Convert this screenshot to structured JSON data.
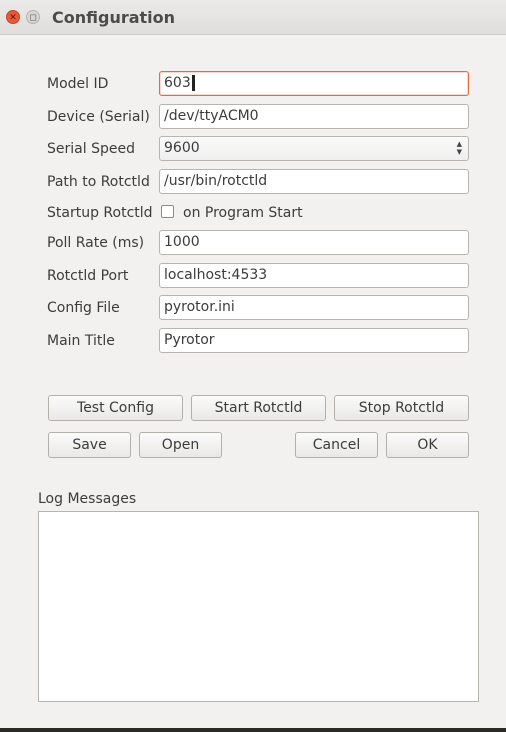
{
  "window": {
    "title": "Configuration",
    "close_glyph": "✕",
    "min_glyph": "◻"
  },
  "form": {
    "model_id": {
      "label": "Model ID",
      "value": "603"
    },
    "device": {
      "label": "Device (Serial)",
      "value": "/dev/ttyACM0"
    },
    "serial_speed": {
      "label": "Serial Speed",
      "value": "9600",
      "spin_up": "▲",
      "spin_down": "▼"
    },
    "rotctld_path": {
      "label": "Path to Rotctld",
      "value": "/usr/bin/rotctld"
    },
    "startup": {
      "label": "Startup Rotctld",
      "checkbox_label": "on Program Start",
      "checked": false
    },
    "poll_rate": {
      "label": "Poll Rate (ms)",
      "value": "1000"
    },
    "rotctld_port": {
      "label": "Rotctld Port",
      "value": "localhost:4533"
    },
    "config_file": {
      "label": "Config File",
      "value": "pyrotor.ini"
    },
    "main_title": {
      "label": "Main Title",
      "value": "Pyrotor"
    }
  },
  "buttons": {
    "test_config": "Test Config",
    "start_rotctld": "Start Rotctld",
    "stop_rotctld": "Stop Rotctld",
    "save": "Save",
    "open": "Open",
    "cancel": "Cancel",
    "ok": "OK"
  },
  "log": {
    "label": "Log Messages"
  },
  "colors": {
    "focus_accent": "#e36c3a",
    "close_button": "#e9583a"
  }
}
